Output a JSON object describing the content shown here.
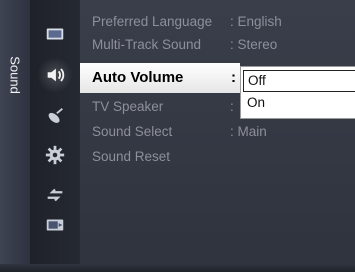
{
  "section": {
    "label": "Sound"
  },
  "icons": [
    "picture-icon",
    "sound-icon",
    "channel-icon",
    "setup-icon",
    "input-icon",
    "application-icon"
  ],
  "menu": {
    "items": [
      {
        "label": "Preferred Language",
        "value": ": English"
      },
      {
        "label": "Multi-Track Sound",
        "value": ": Stereo"
      },
      {
        "label": "Auto Volume",
        "value": ":"
      },
      {
        "label": "TV Speaker",
        "value": ":"
      },
      {
        "label": "Sound Select",
        "value": ": Main"
      },
      {
        "label": "Sound Reset",
        "value": ""
      }
    ]
  },
  "dropdown": {
    "options": [
      "Off",
      "On"
    ],
    "selected": "Off"
  },
  "colors": {
    "panel": "#3a3e4a",
    "highlight": "#ffffff",
    "dim_text": "#8d909a"
  }
}
